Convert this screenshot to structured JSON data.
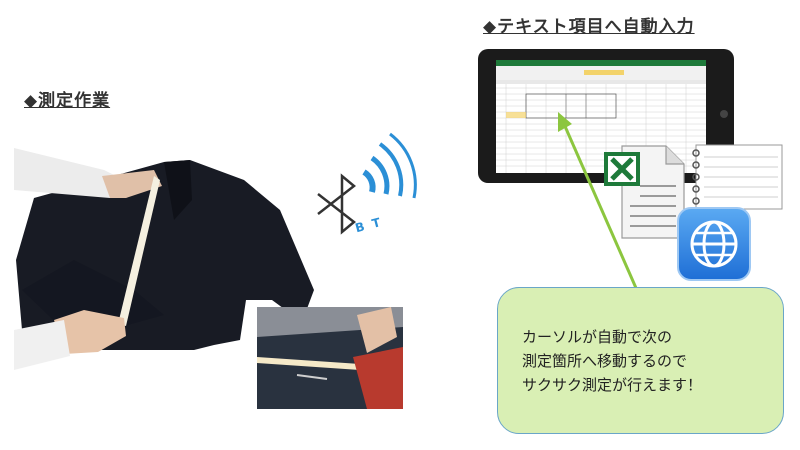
{
  "left_heading": "◆測定作業",
  "right_heading": "◆テキスト項目へ自動入力",
  "bt_label": "B T",
  "callout_lines": [
    "カーソルが自動で次の",
    "測定箇所へ移動するので",
    "サクサク測定が行えます！"
  ],
  "colors": {
    "callout_fill": "#d9efb4",
    "callout_border": "#6aa6c8",
    "arrow": "#8cc63f",
    "bt_arc": "#2b8fd6",
    "excel_green": "#1e7a3a",
    "globe_blue": "#2a7fe0"
  }
}
